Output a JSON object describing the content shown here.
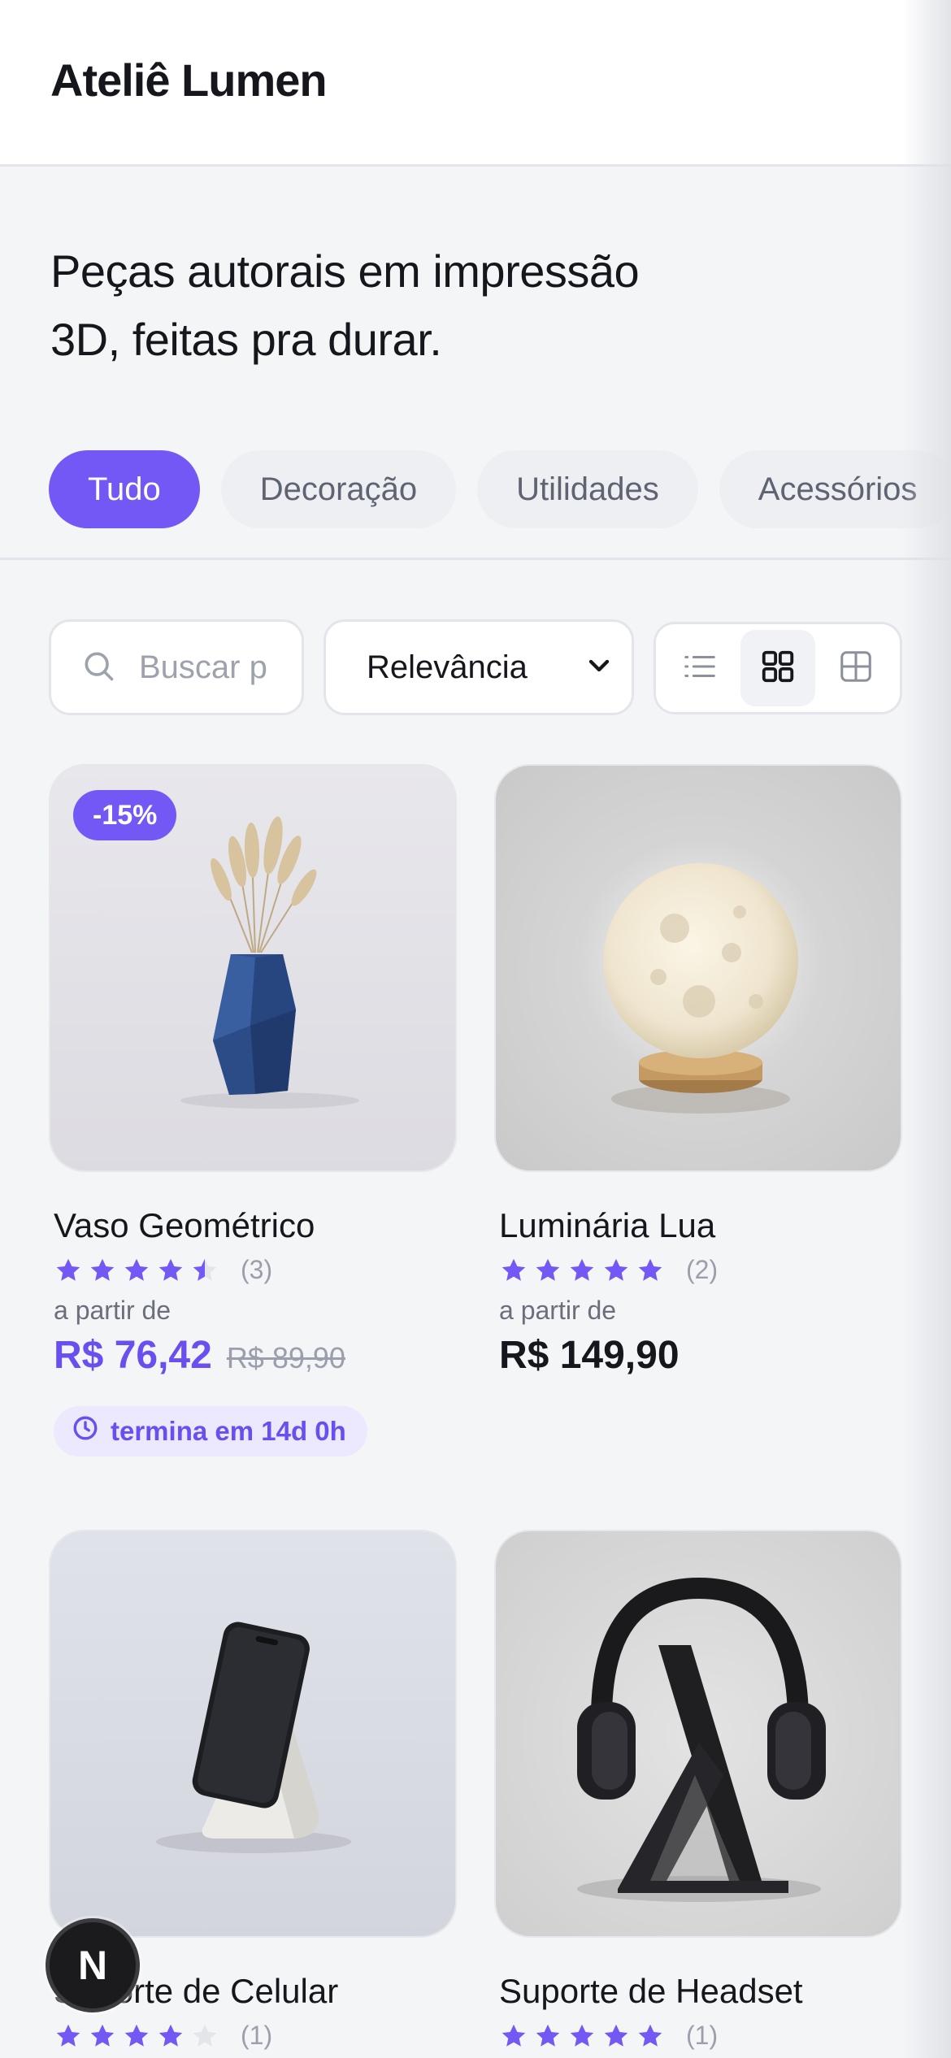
{
  "header": {
    "brand": "Ateliê Lumen"
  },
  "hero": {
    "line1": "Peças autorais em impressão",
    "line2": "3D, feitas pra durar."
  },
  "categories": [
    {
      "label": "Tudo",
      "active": true
    },
    {
      "label": "Decoração",
      "active": false
    },
    {
      "label": "Utilidades",
      "active": false
    },
    {
      "label": "Acessórios",
      "active": false
    }
  ],
  "toolbar": {
    "search_placeholder": "Buscar p",
    "sort_value": "Relevância",
    "view_modes": [
      "list-icon",
      "grid-2-icon",
      "grid-3-icon"
    ],
    "active_view": "grid-2-icon"
  },
  "products": [
    {
      "name": "Vaso Geométrico",
      "rating": 4.5,
      "reviews": "(3)",
      "from_label": "a partir de",
      "price": "R$ 76,42",
      "old_price": "R$ 89,90",
      "badge": "-15%",
      "timer": "termina em 14d 0h"
    },
    {
      "name": "Luminária Lua",
      "rating": 5,
      "reviews": "(2)",
      "from_label": "a partir de",
      "price": "R$ 149,90"
    },
    {
      "name": "Suporte de Celular",
      "rating": 4,
      "reviews": "(1)"
    },
    {
      "name": "Suporte de Headset",
      "rating": 5,
      "reviews": "(1)"
    }
  ],
  "colors": {
    "accent": "#7458f5",
    "background": "#f4f5f7",
    "star": "#7458f5",
    "star_empty": "#e4e5e9"
  },
  "fab": {
    "label": "N"
  }
}
